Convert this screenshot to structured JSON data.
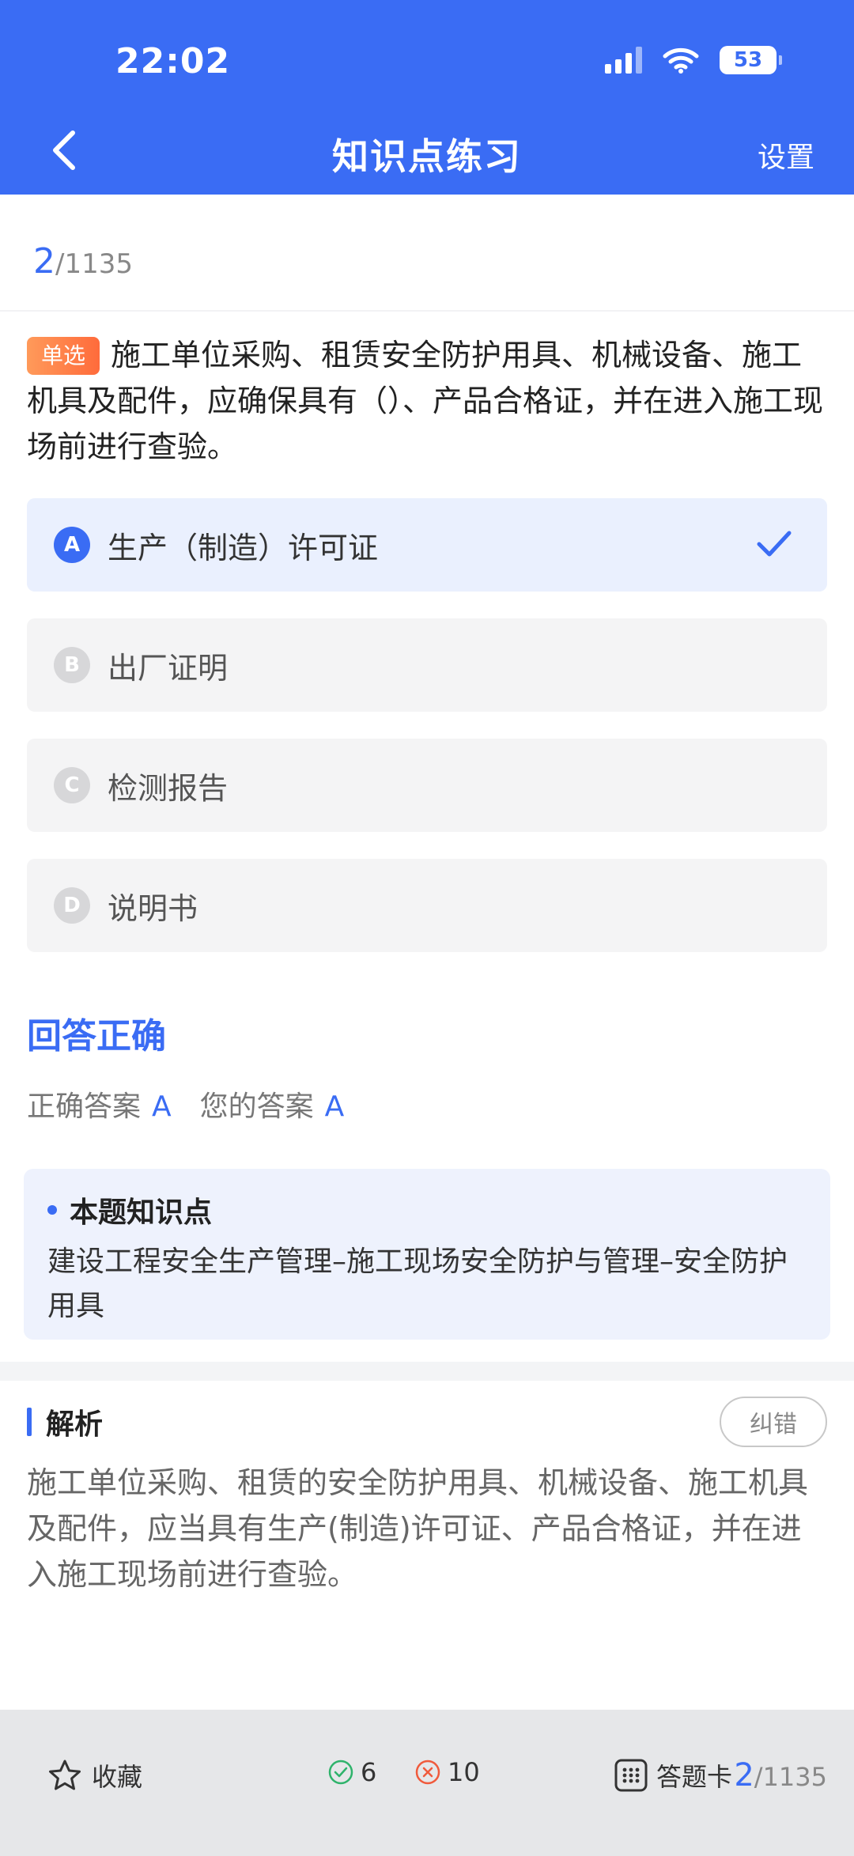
{
  "status": {
    "time": "22:02",
    "battery": "53"
  },
  "nav": {
    "title": "知识点练习",
    "settings": "设置"
  },
  "progress": {
    "current": "2",
    "total": "/1135"
  },
  "question": {
    "type_tag": "单选",
    "text": "施工单位采购、租赁安全防护用具、机械设备、施工机具及配件，应确保具有（）、产品合格证，并在进入施工现场前进行查验。"
  },
  "options": [
    {
      "letter": "A",
      "text": "生产（制造）许可证",
      "selected": true
    },
    {
      "letter": "B",
      "text": "出厂证明"
    },
    {
      "letter": "C",
      "text": "检测报告"
    },
    {
      "letter": "D",
      "text": "说明书"
    }
  ],
  "result": {
    "title": "回答正确",
    "correct_label": "正确答案",
    "correct_value": "A",
    "your_label": "您的答案",
    "your_value": "A"
  },
  "knowledge": {
    "title": "本题知识点",
    "text": "建设工程安全生产管理–施工现场安全防护与管理–安全防护用具"
  },
  "analysis": {
    "title": "解析",
    "correct_button": "纠错",
    "text": "施工单位采购、租赁的安全防护用具、机械设备、施工机具及配件，应当具有生产(制造)许可证、产品合格证，并在进入施工现场前进行查验。"
  },
  "bottom": {
    "favorite": "收藏",
    "right_count": "6",
    "wrong_count": "10",
    "answer_card": "答题卡",
    "current": "2",
    "total": "/1135"
  },
  "colors": {
    "primary": "#3a6cf4",
    "tag": "#ff7a45",
    "right": "#2fb36b",
    "wrong": "#f05a3c"
  }
}
